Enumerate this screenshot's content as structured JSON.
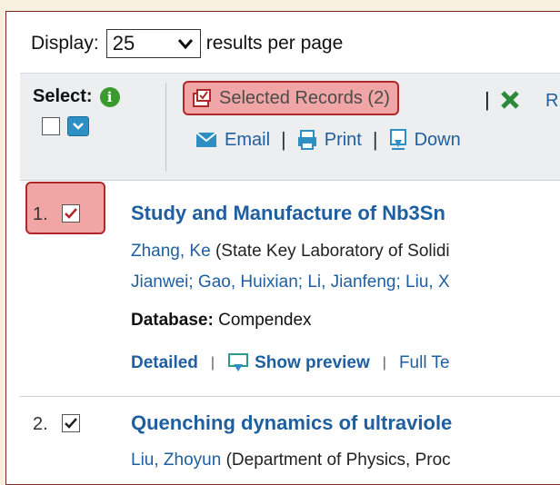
{
  "display": {
    "label": "Display:",
    "value": "25",
    "suffix": "results per page"
  },
  "toolbar": {
    "select_label": "Select:",
    "selected_records": "Selected Records (2)",
    "remove_partial": "R",
    "email": "Email",
    "print": "Print",
    "download_partial": "Down"
  },
  "results": [
    {
      "number": "1.",
      "checked": true,
      "title": "Study and Manufacture of Nb3Sn",
      "author_line1_name": "Zhang, Ke",
      "author_line1_aff": " (State Key Laboratory of Solidi",
      "author_line2": "Jianwei; Gao, Huixian; Li, Jianfeng; Liu, X",
      "database_label": "Database:",
      "database_value": "Compendex",
      "detailed": "Detailed",
      "show_preview": "Show preview",
      "full_text": "Full Te"
    },
    {
      "number": "2.",
      "checked": true,
      "title": "Quenching dynamics of ultraviole",
      "author_line1_name": "Liu, Zhoyun",
      "author_line1_aff": " (Department of Physics, Proc"
    }
  ],
  "colors": {
    "link": "#1f5fa0",
    "highlight": "#f0a6a6",
    "highlight_border": "#b0272a",
    "brand_green": "#3a9a2e"
  }
}
